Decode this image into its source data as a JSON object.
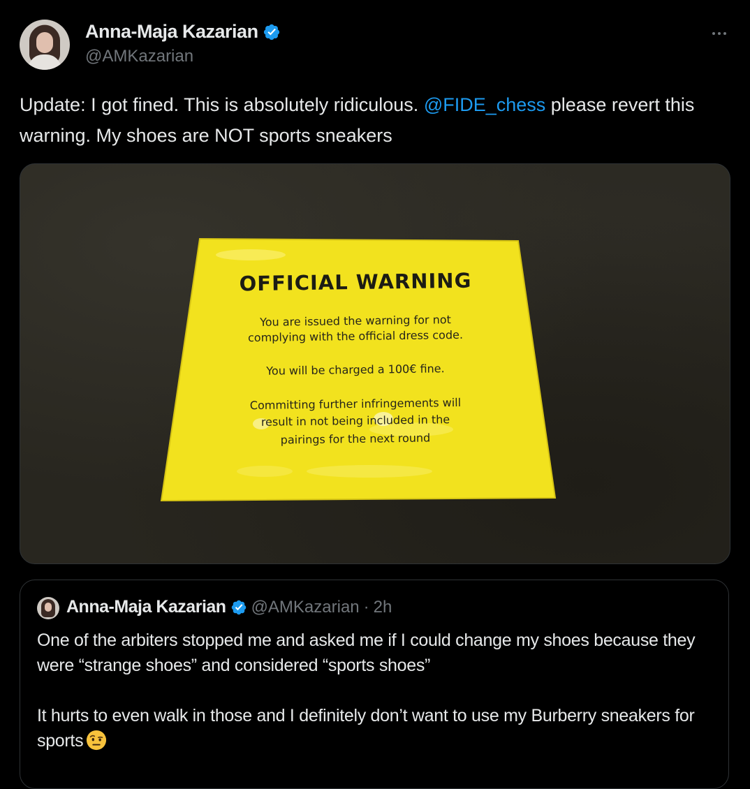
{
  "tweet": {
    "author": {
      "display_name": "Anna-Maja Kazarian",
      "handle": "@AMKazarian",
      "verified_icon": "verified-badge-icon"
    },
    "more_icon": "more-horizontal-icon",
    "text": {
      "before_mention": "Update: I got fined. This is absolutely ridiculous. ",
      "mention": "@FIDE_chess",
      "after_mention": " please revert this warning. My shoes are NOT sports sneakers"
    },
    "media": {
      "card_title": "OFFICIAL WARNING",
      "card_lines": [
        "You are issued the warning for not",
        "complying with the official dress code.",
        "You will be charged a 100€ fine.",
        "Committing further infringements will",
        "result in not being included in the",
        "pairings for the next round"
      ]
    }
  },
  "quote": {
    "author": {
      "display_name": "Anna-Maja Kazarian",
      "handle": "@AMKazarian",
      "separator": "·",
      "time": "2h"
    },
    "paragraphs": [
      "One of the arbiters stopped me and asked me if I could change my shoes because they were “strange shoes” and considered “sports shoes”",
      "It hurts to even walk in those and I definitely don’t want to use my Burberry sneakers for sports"
    ],
    "emoji": "face-with-raised-eyebrow-icon"
  },
  "colors": {
    "background": "#000000",
    "text": "#e7e9ea",
    "secondary": "#71767b",
    "accent": "#1d9bf0",
    "border": "#2f3336",
    "warning_yellow": "#f2e21e"
  }
}
